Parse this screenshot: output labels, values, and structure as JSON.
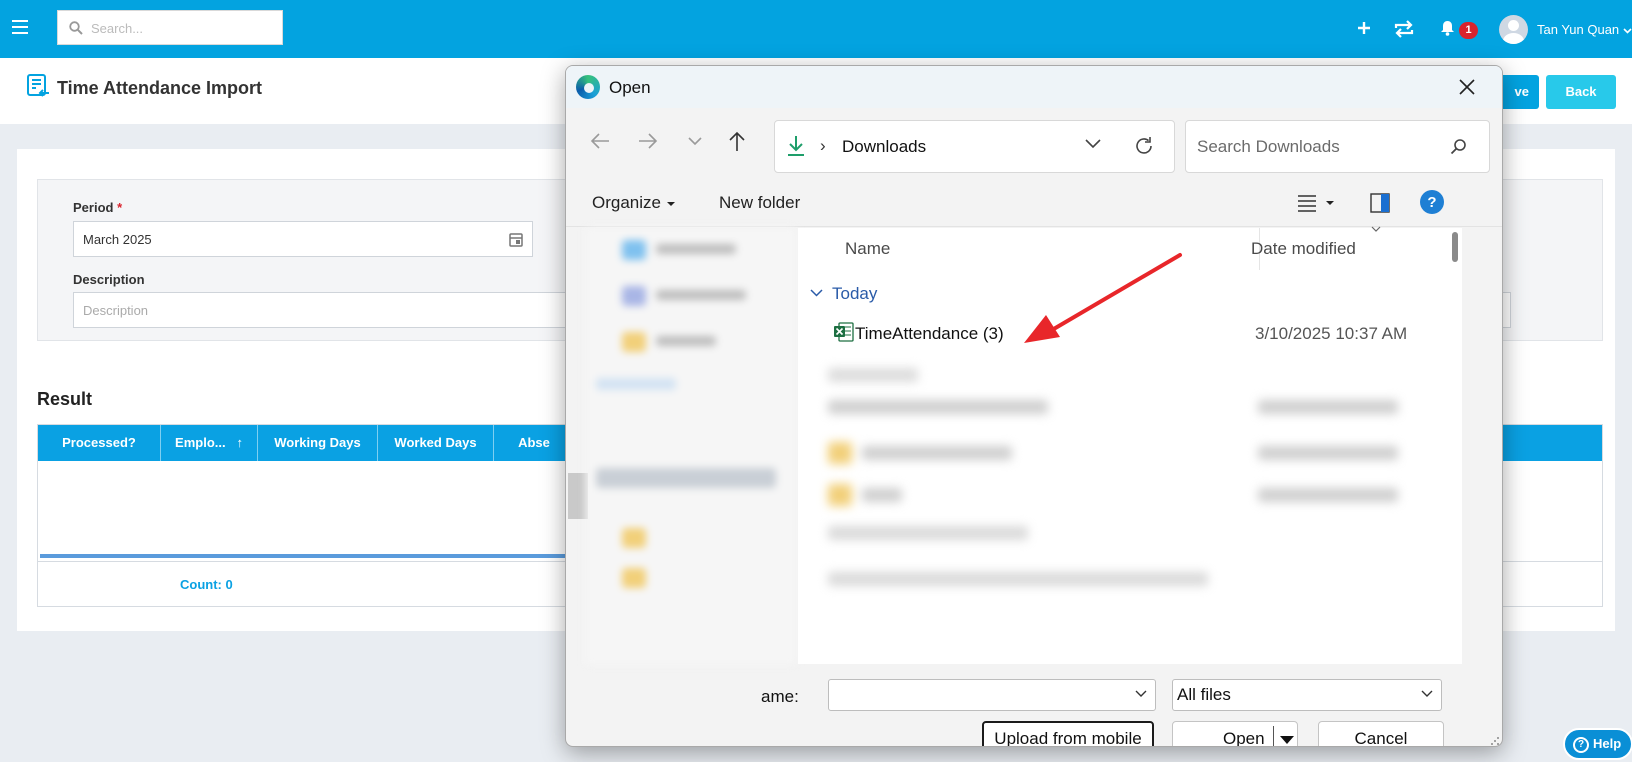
{
  "topbar": {
    "search_placeholder": "Search...",
    "notification_count": "1",
    "user_name": "Tan Yun Quan"
  },
  "page": {
    "title": "Time Attendance Import",
    "save_label": "ve",
    "back_label": "Back"
  },
  "form": {
    "period_label": "Period",
    "period_required": "*",
    "period_value": "March 2025",
    "description_label": "Description",
    "description_placeholder": "Description"
  },
  "result": {
    "title": "Result",
    "columns": [
      "Processed?",
      "Emplo...",
      "Working Days",
      "Worked Days",
      "Abse"
    ],
    "sort_indicator": "↑",
    "count_label": "Count: 0"
  },
  "help_label": "Help",
  "dialog": {
    "title": "Open",
    "location": "Downloads",
    "search_placeholder": "Search Downloads",
    "organize_label": "Organize",
    "new_folder_label": "New folder",
    "columns": {
      "name": "Name",
      "date_modified": "Date modified"
    },
    "group_label": "Today",
    "file": {
      "name": "TimeAttendance (3)",
      "date": "3/10/2025 10:37 AM"
    },
    "filename_label": "ame:",
    "filename_value": "",
    "filter_value": "All files",
    "buttons": {
      "upload": "Upload from mobile",
      "open": "Open",
      "cancel": "Cancel"
    }
  }
}
